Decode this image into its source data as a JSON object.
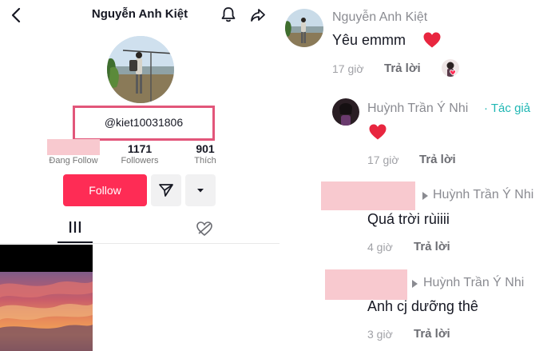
{
  "profile": {
    "title": "Nguyễn Anh Kiệt",
    "handle": "@kiet10031806",
    "stats": [
      {
        "value": "",
        "label": "Đang Follow"
      },
      {
        "value": "1171",
        "label": "Followers"
      },
      {
        "value": "901",
        "label": "Thích"
      }
    ],
    "follow_label": "Follow",
    "icons": {
      "back": "back-arrow-icon",
      "bell": "bell-icon",
      "share": "share-icon",
      "send": "send-icon",
      "more": "caret-down-icon",
      "grid_tab": "grid-icon",
      "liked_tab": "liked-heart-icon"
    }
  },
  "comments": [
    {
      "author": "Nguyễn Anh Kiệt",
      "text": "Yêu emmm",
      "time": "17 giờ",
      "reply_label": "Trả lời"
    },
    {
      "author": "Huỳnh Trần Ý Nhi",
      "author_tag": "· Tác giả",
      "time": "17 giờ",
      "reply_label": "Trả lời"
    },
    {
      "author": "",
      "reply_to": "Huỳnh Trần Ý Nhi",
      "text": "Quá trời rùiiii",
      "time": "4 giờ",
      "reply_label": "Trả lời"
    },
    {
      "author": "",
      "reply_to": "Huỳnh Trần Ý Nhi",
      "text": "Anh cj dưỡng thê",
      "time": "3 giờ",
      "reply_label": "Trả lời"
    }
  ],
  "colors": {
    "follow_button": "#fe2c55",
    "highlight_box": "#e2567a",
    "redaction": "#f8c9cf",
    "author_tag": "#20b7b4",
    "heart": "#e8263f"
  }
}
